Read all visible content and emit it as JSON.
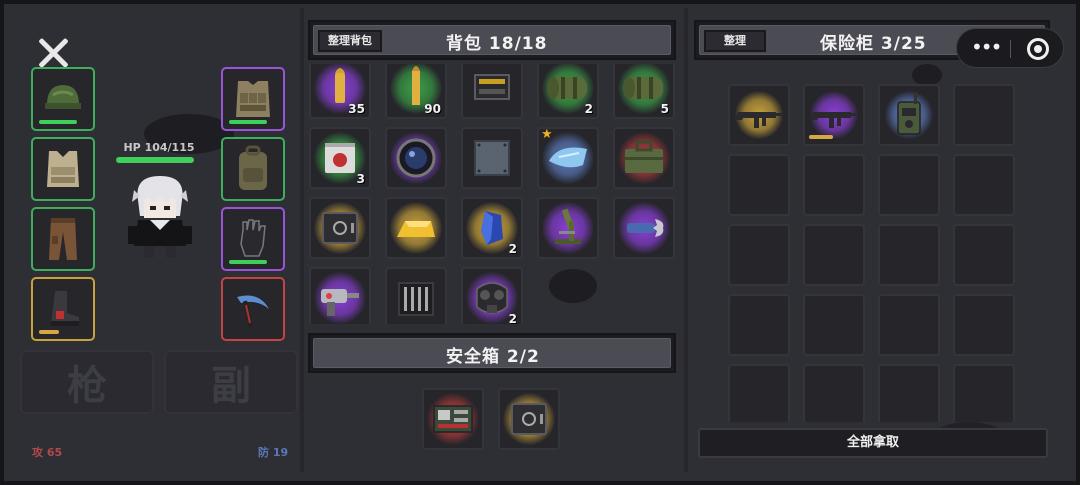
{
  "left": {
    "hp_label": "HP 104/115",
    "hp_fraction": 0.904,
    "weapon_slot_label": "枪",
    "secondary_slot_label": "副",
    "attack_label": "攻 65",
    "defense_label": "防 19"
  },
  "backpack": {
    "sort_button": "整理背包",
    "title": "背包 18/18",
    "items": [
      {
        "name": "pistol-ammo",
        "glow": "#8a3fd6",
        "count": "35",
        "star": false
      },
      {
        "name": "rifle-ammo",
        "glow": "#3aa046",
        "count": "90",
        "star": false
      },
      {
        "name": "ammo-box",
        "glow": "none",
        "count": "",
        "star": false
      },
      {
        "name": "camo-bedroll",
        "glow": "#3aa046",
        "count": "2",
        "star": false
      },
      {
        "name": "camo-bedroll",
        "glow": "#3aa046",
        "count": "5",
        "star": false
      },
      {
        "name": "meat-can",
        "glow": "#3aa046",
        "count": "3",
        "star": false
      },
      {
        "name": "lens",
        "glow": "#8a3fd6",
        "count": "",
        "star": false
      },
      {
        "name": "metal-plate",
        "glow": "none",
        "count": "",
        "star": false
      },
      {
        "name": "ice-shard",
        "glow": "#5a78b8",
        "count": "",
        "star": true
      },
      {
        "name": "toolbox",
        "glow": "#b03a3a",
        "count": "",
        "star": false
      },
      {
        "name": "safe",
        "glow": "#c8a23a",
        "count": "",
        "star": false
      },
      {
        "name": "gold-bar",
        "glow": "#c8a23a",
        "count": "",
        "star": false
      },
      {
        "name": "blue-crystal",
        "glow": "#c8a23a",
        "count": "2",
        "star": false
      },
      {
        "name": "microscope",
        "glow": "#8a3fd6",
        "count": "",
        "star": false
      },
      {
        "name": "wrench",
        "glow": "#8a3fd6",
        "count": "",
        "star": false
      },
      {
        "name": "drill",
        "glow": "#8a3fd6",
        "count": "",
        "star": false
      },
      {
        "name": "knife-set",
        "glow": "none",
        "count": "",
        "star": false
      },
      {
        "name": "gas-mask",
        "glow": "#8a3fd6",
        "count": "2",
        "star": false
      }
    ]
  },
  "safebox": {
    "title": "安全箱 2/2",
    "items": [
      {
        "name": "circuit-board",
        "glow": "#b03a3a"
      },
      {
        "name": "safe",
        "glow": "#c8a23a"
      }
    ]
  },
  "vault": {
    "sort_button": "整理",
    "title": "保险柜 3/25",
    "items": [
      {
        "name": "assault-rifle",
        "glow": "#c8a23a",
        "bar": false
      },
      {
        "name": "assault-rifle",
        "glow": "#8a3fd6",
        "bar": true
      },
      {
        "name": "radio",
        "glow": "#5a78b8",
        "bar": false
      }
    ],
    "take_all_button": "全部拿取"
  },
  "equipment": [
    {
      "name": "helmet",
      "rarity": "green"
    },
    {
      "name": "vest",
      "rarity": "green"
    },
    {
      "name": "pants",
      "rarity": "green"
    },
    {
      "name": "boots",
      "rarity": "yellow"
    },
    {
      "name": "armor-rig",
      "rarity": "purple"
    },
    {
      "name": "backpack",
      "rarity": "green"
    },
    {
      "name": "gloves",
      "rarity": "purple"
    },
    {
      "name": "scythe",
      "rarity": "red"
    }
  ]
}
